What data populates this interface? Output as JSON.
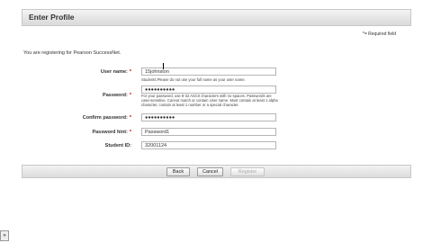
{
  "header": {
    "title": "Enter Profile"
  },
  "required_note": "*= Required field",
  "intro": "You are registering for Pearson SuccessNet.",
  "form": {
    "username": {
      "label": "User name:",
      "value": "15johnston",
      "help": "Students:Please do not use your full name as your user name."
    },
    "password": {
      "label": "Password:",
      "value": "●●●●●●●●●●",
      "help": "For your password, use 8-32 ASCII characters with no spaces. Passwords are case-sensitive. Cannot match or contain User name. Must contain at least 1 alpha character, contain at least 1 number or a special character."
    },
    "confirm": {
      "label": "Confirm password:",
      "value": "●●●●●●●●●●"
    },
    "hint": {
      "label": "Password hint:",
      "value": "Password1"
    },
    "student_id": {
      "label": "Student ID:",
      "value": "32001124"
    },
    "required_mark": "*"
  },
  "buttons": {
    "back": "Back",
    "cancel": "Cancel",
    "register": "Register"
  },
  "corner_icon": "expand-icon"
}
